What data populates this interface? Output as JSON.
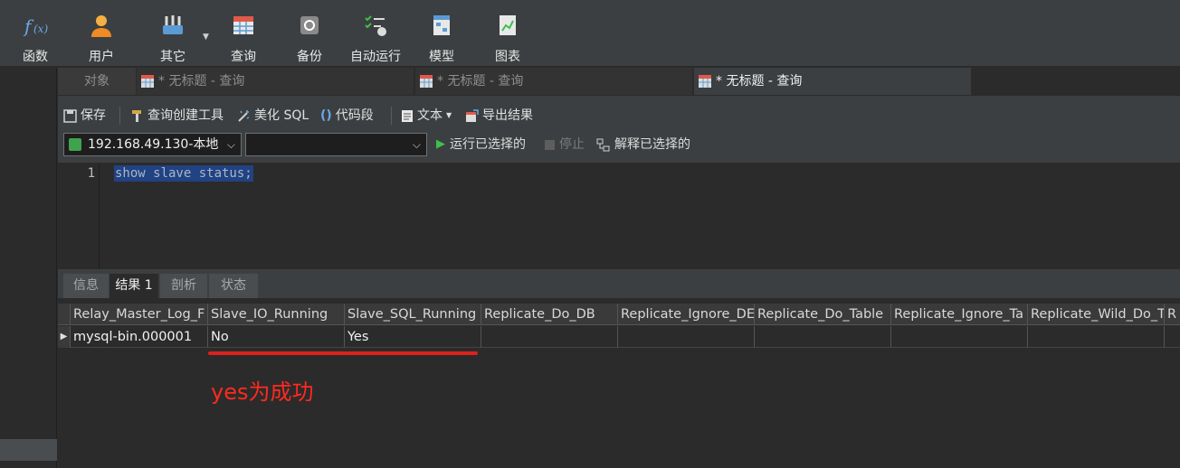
{
  "toolbar": {
    "items": [
      {
        "label": "函数",
        "icon": "function-icon"
      },
      {
        "label": "用户",
        "icon": "user-icon"
      },
      {
        "label": "其它",
        "icon": "other-tools-icon"
      },
      {
        "label": "查询",
        "icon": "query-icon"
      },
      {
        "label": "备份",
        "icon": "backup-icon"
      },
      {
        "label": "自动运行",
        "icon": "auto-run-icon"
      },
      {
        "label": "模型",
        "icon": "model-icon"
      },
      {
        "label": "图表",
        "icon": "chart-icon"
      }
    ]
  },
  "tabs": {
    "objects": "对象",
    "query_tabs": [
      "* 无标题 - 查询",
      "* 无标题 - 查询",
      "* 无标题 - 查询"
    ]
  },
  "query_toolbar": {
    "save": "保存",
    "builder": "查询创建工具",
    "beautify": "美化 SQL",
    "snippet": "代码段",
    "text": "文本",
    "export": "导出结果",
    "connection": "192.168.49.130-本地",
    "database": "",
    "run_selected": "运行已选择的",
    "stop": "停止",
    "explain_selected": "解释已选择的"
  },
  "editor": {
    "line_number": "1",
    "code": "show slave status;"
  },
  "result_tabs": [
    "信息",
    "结果 1",
    "剖析",
    "状态"
  ],
  "grid": {
    "columns": [
      "Relay_Master_Log_F",
      "Slave_IO_Running",
      "Slave_SQL_Running",
      "Replicate_Do_DB",
      "Replicate_Ignore_DE",
      "Replicate_Do_Table",
      "Replicate_Ignore_Ta",
      "Replicate_Wild_Do_T",
      "R"
    ],
    "rows": [
      [
        "mysql-bin.000001",
        "No",
        "Yes",
        "",
        "",
        "",
        "",
        "",
        ""
      ]
    ]
  },
  "annotation": "yes为成功",
  "colors": {
    "accent_red": "#e0201c",
    "selection": "#214283",
    "run_green": "#3fbf4a"
  }
}
